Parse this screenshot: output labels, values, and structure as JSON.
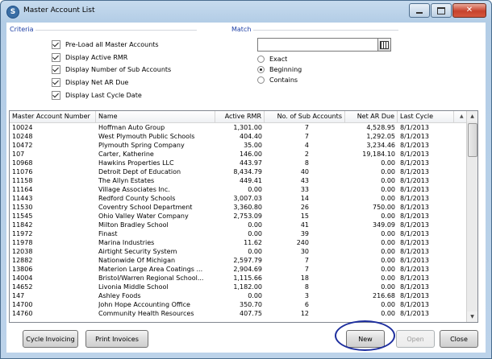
{
  "window": {
    "title": "Master Account List",
    "app_icon_letter": "S"
  },
  "criteria": {
    "label": "Criteria",
    "options": [
      {
        "label": "Pre-Load all Master Accounts",
        "checked": true
      },
      {
        "label": "Display Active RMR",
        "checked": true
      },
      {
        "label": "Display Number of Sub Accounts",
        "checked": true
      },
      {
        "label": "Display Net AR Due",
        "checked": true
      },
      {
        "label": "Display Last Cycle Date",
        "checked": true
      }
    ]
  },
  "match": {
    "label": "Match",
    "input_value": "",
    "radios": [
      {
        "label": "Exact",
        "selected": false
      },
      {
        "label": "Beginning",
        "selected": true
      },
      {
        "label": "Contains",
        "selected": false
      }
    ]
  },
  "table": {
    "columns": [
      "Master Account Number",
      "Name",
      "Active RMR",
      "No. of Sub Accounts",
      "Net AR Due",
      "Last Cycle"
    ],
    "rows": [
      [
        "10024",
        "Hoffman Auto Group",
        "1,301.00",
        "7",
        "4,528.95",
        "8/1/2013"
      ],
      [
        "10248",
        "West Plymouth Public Schools",
        "404.40",
        "7",
        "1,292.05",
        "8/1/2013"
      ],
      [
        "10472",
        "Plymouth Spring Company",
        "35.00",
        "4",
        "3,234.46",
        "8/1/2013"
      ],
      [
        "107",
        "Carter, Katherine",
        "146.00",
        "2",
        "19,184.10",
        "8/1/2013"
      ],
      [
        "10968",
        "Hawkins Properties LLC",
        "443.97",
        "8",
        "0.00",
        "8/1/2013"
      ],
      [
        "11076",
        "Detroit Dept of Education",
        "8,434.79",
        "40",
        "0.00",
        "8/1/2013"
      ],
      [
        "11158",
        "The Allyn Estates",
        "449.41",
        "43",
        "0.00",
        "8/1/2013"
      ],
      [
        "11164",
        "Village Associates Inc.",
        "0.00",
        "33",
        "0.00",
        "8/1/2013"
      ],
      [
        "11443",
        "Redford County Schools",
        "3,007.03",
        "14",
        "0.00",
        "8/1/2013"
      ],
      [
        "11530",
        "Coventry School Department",
        "3,360.80",
        "26",
        "750.00",
        "8/1/2013"
      ],
      [
        "11545",
        "Ohio Valley Water Company",
        "2,753.09",
        "15",
        "0.00",
        "8/1/2013"
      ],
      [
        "11842",
        "Milton Bradley School",
        "0.00",
        "41",
        "349.09",
        "8/1/2013"
      ],
      [
        "11972",
        "Finast",
        "0.00",
        "39",
        "0.00",
        "8/1/2013"
      ],
      [
        "11978",
        "Marina Industries",
        "11.62",
        "240",
        "0.00",
        "8/1/2013"
      ],
      [
        "12038",
        "Airtight Security System",
        "0.00",
        "30",
        "0.00",
        "8/1/2013"
      ],
      [
        "12882",
        "Nationwide Of Michigan",
        "2,597.79",
        "7",
        "0.00",
        "8/1/2013"
      ],
      [
        "13806",
        "Materion Large Area Coatings ...",
        "2,904.69",
        "7",
        "0.00",
        "8/1/2013"
      ],
      [
        "14004",
        "Bristol/Warren Regional School...",
        "1,115.66",
        "18",
        "0.00",
        "8/1/2013"
      ],
      [
        "14652",
        "Livonia Middle School",
        "1,182.00",
        "8",
        "0.00",
        "8/1/2013"
      ],
      [
        "147",
        "Ashley Foods",
        "0.00",
        "3",
        "216.68",
        "8/1/2013"
      ],
      [
        "14700",
        "John Hope Accounting Office",
        "350.70",
        "6",
        "0.00",
        "8/1/2013"
      ],
      [
        "14760",
        "Community Health Resources",
        "407.75",
        "12",
        "0.00",
        "8/1/2013"
      ]
    ]
  },
  "buttons": {
    "cycle_invoicing": "Cycle Invoicing",
    "print_invoices": "Print Invoices",
    "new": "New",
    "open": "Open",
    "close": "Close"
  },
  "colors": {
    "section_label": "#1e3fa5",
    "highlight_ring": "#1d2e9e",
    "window_frame": "#b3cde6"
  }
}
